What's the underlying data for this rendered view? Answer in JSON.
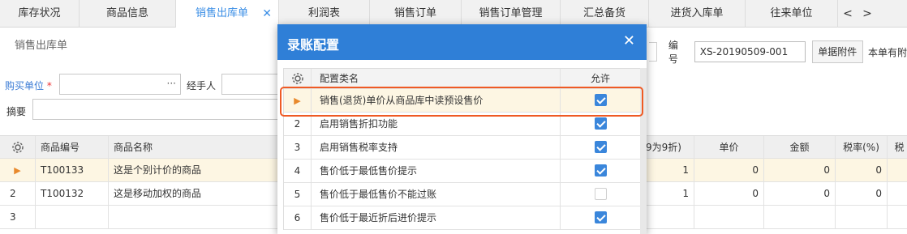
{
  "tabs": [
    {
      "label": "库存状况",
      "active": false
    },
    {
      "label": "商品信息",
      "active": false
    },
    {
      "label": "销售出库单",
      "active": true
    },
    {
      "label": "利润表",
      "active": false
    },
    {
      "label": "销售订单",
      "active": false
    },
    {
      "label": "销售订单管理",
      "active": false
    },
    {
      "label": "汇总备货",
      "active": false
    },
    {
      "label": "进货入库单",
      "active": false
    },
    {
      "label": "往来单位",
      "active": false
    }
  ],
  "tab_close": "✕",
  "tab_prev": "<",
  "tab_next": ">",
  "page": {
    "title": "销售出库单",
    "number_label": "编号",
    "number_value": "XS-20190509-001",
    "attach_button": "单据附件",
    "trail_text": "本单有附"
  },
  "form": {
    "buyer_label": "购买单位",
    "required_mark": "*",
    "buyer_dots": "···",
    "handler_label": "经手人",
    "memo_label": "摘要"
  },
  "grid": {
    "headers": {
      "code": "商品编号",
      "name": "商品名称",
      "discount": "9为9折)",
      "price": "单价",
      "amount": "金额",
      "tax": "税率(%)",
      "tail": "税"
    },
    "rows": [
      {
        "idx": "",
        "code": "T100133",
        "name": "这是个别计价的商品",
        "discount": "1",
        "price": "0",
        "amount": "0",
        "tax": "0",
        "selected": true
      },
      {
        "idx": "2",
        "code": "T100132",
        "name": "这是移动加权的商品",
        "discount": "1",
        "price": "0",
        "amount": "0",
        "tax": "0",
        "selected": false
      },
      {
        "idx": "3",
        "code": "",
        "name": "",
        "discount": "",
        "price": "",
        "amount": "",
        "tax": "",
        "selected": false
      }
    ]
  },
  "modal": {
    "title": "录账配置",
    "close": "✕",
    "col_name": "配置类名",
    "col_allow": "允许",
    "rows": [
      {
        "idx": "",
        "name": "销售(退货)单价从商品库中读预设售价",
        "allowed": true,
        "selected": true
      },
      {
        "idx": "2",
        "name": "启用销售折扣功能",
        "allowed": true,
        "selected": false
      },
      {
        "idx": "3",
        "name": "启用销售税率支持",
        "allowed": true,
        "selected": false
      },
      {
        "idx": "4",
        "name": "售价低于最低售价提示",
        "allowed": true,
        "selected": false
      },
      {
        "idx": "5",
        "name": "售价低于最低售价不能过账",
        "allowed": false,
        "selected": false
      },
      {
        "idx": "6",
        "name": "售价低于最近折后进价提示",
        "allowed": true,
        "selected": false
      }
    ]
  },
  "colors": {
    "accent": "#2f7fd7",
    "highlight": "#ef5a24",
    "selected_row": "#fdf6e3",
    "checkbox": "#3a86db"
  }
}
